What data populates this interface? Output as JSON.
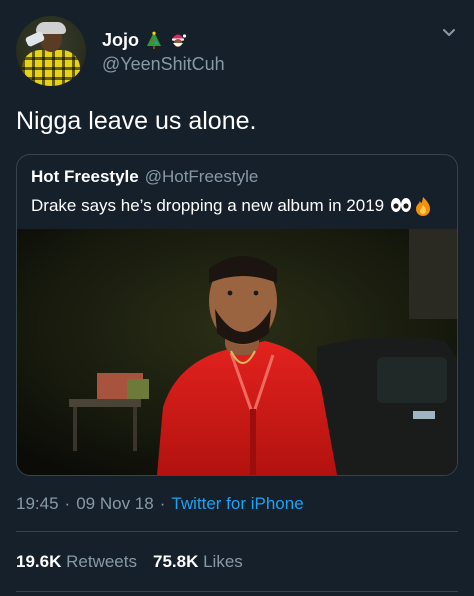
{
  "author": {
    "display_name": "Jojo",
    "handle": "@YeenShitCuh",
    "name_emojis": [
      "christmas-tree-emoji",
      "santa-emoji"
    ]
  },
  "tweet": {
    "text": "Nigga leave us alone."
  },
  "quoted_tweet": {
    "display_name": "Hot Freestyle",
    "handle": "@HotFreestyle",
    "text": "Drake says he’s dropping a new album in 2019",
    "text_emojis": [
      "eyes-emoji",
      "fire-emoji"
    ],
    "image": "photo-man-red-jacket"
  },
  "meta": {
    "time": "19:45",
    "sep1": "·",
    "date": "09 Nov 18",
    "sep2": "·",
    "source": "Twitter for iPhone"
  },
  "stats": {
    "retweets_count": "19.6K",
    "retweets_label": "Retweets",
    "likes_count": "75.8K",
    "likes_label": "Likes"
  },
  "colors": {
    "background": "#15202b",
    "text": "#ffffff",
    "secondary": "#8899a6",
    "link": "#1da1f2",
    "border": "#38444d"
  }
}
